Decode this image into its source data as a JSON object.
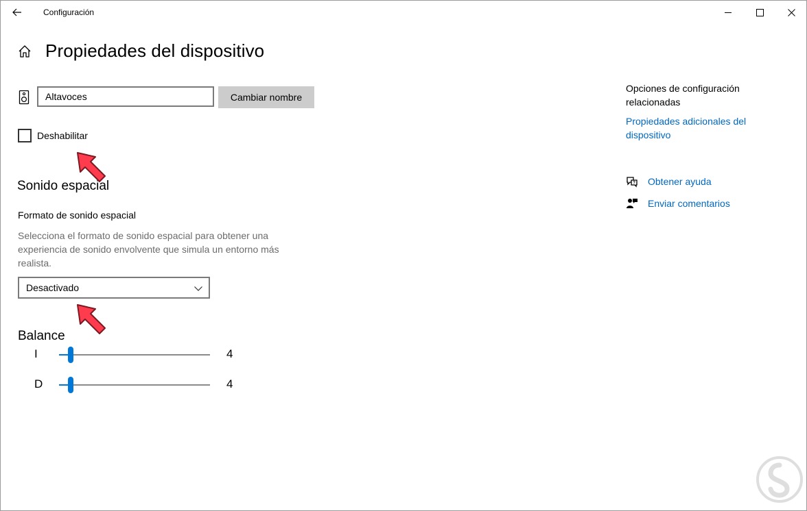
{
  "window": {
    "app_title": "Configuración",
    "controls": {
      "minimize": "minimize-icon",
      "maximize": "maximize-icon",
      "close": "close-icon"
    }
  },
  "header": {
    "title": "Propiedades del dispositivo"
  },
  "device": {
    "name_value": "Altavoces",
    "rename_label": "Cambiar nombre",
    "disable_label": "Deshabilitar",
    "disable_checked": false
  },
  "spatial": {
    "section_title": "Sonido espacial",
    "format_label": "Formato de sonido espacial",
    "description": "Selecciona el formato de sonido espacial para obtener una experiencia de sonido envolvente que simula un entorno más realista.",
    "selected_format": "Desactivado"
  },
  "balance": {
    "section_title": "Balance",
    "channels": [
      {
        "label": "I",
        "value": "4",
        "level": 4
      },
      {
        "label": "D",
        "value": "4",
        "level": 4
      }
    ]
  },
  "related": {
    "title": "Opciones de configuración relacionadas",
    "link": "Propiedades adicionales del dispositivo"
  },
  "help": {
    "get_help": "Obtener ayuda",
    "feedback": "Enviar comentarios"
  },
  "colors": {
    "accent": "#0078d7",
    "link": "#0067c0",
    "annotation_arrow": "#ff3b4e"
  }
}
